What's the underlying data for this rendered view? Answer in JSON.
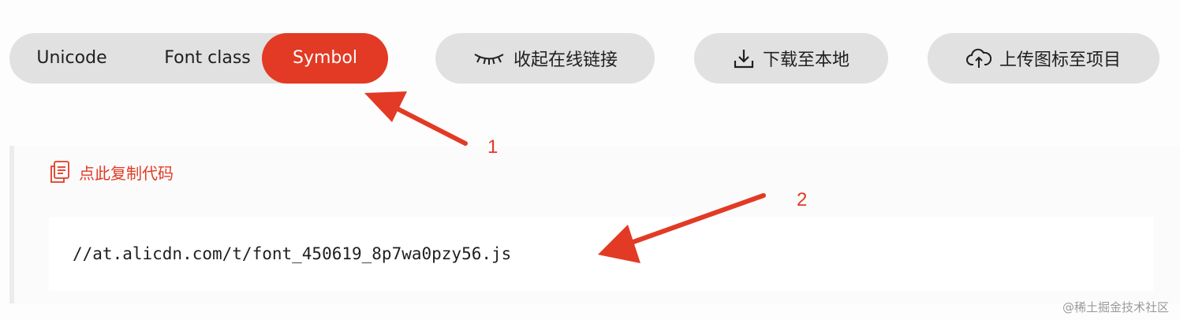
{
  "tabs": [
    {
      "label": "Unicode",
      "active": false
    },
    {
      "label": "Font class",
      "active": false
    },
    {
      "label": "Symbol",
      "active": true
    }
  ],
  "actions": {
    "collapse_label": "收起在线链接",
    "download_label": "下载至本地",
    "upload_label": "上传图标至项目"
  },
  "copy": {
    "label": "点此复制代码"
  },
  "code": {
    "url": "//at.alicdn.com/t/font_450619_8p7wa0pzy56.js"
  },
  "annotations": {
    "n1": "1",
    "n2": "2"
  },
  "watermark": "@稀土掘金技术社区",
  "colors": {
    "accent": "#e23a24",
    "pill_bg": "#e1e1e1"
  },
  "icons": {
    "collapse": "closed-eye-icon",
    "download": "download-icon",
    "upload": "cloud-upload-icon",
    "copy": "copy-document-icon"
  }
}
